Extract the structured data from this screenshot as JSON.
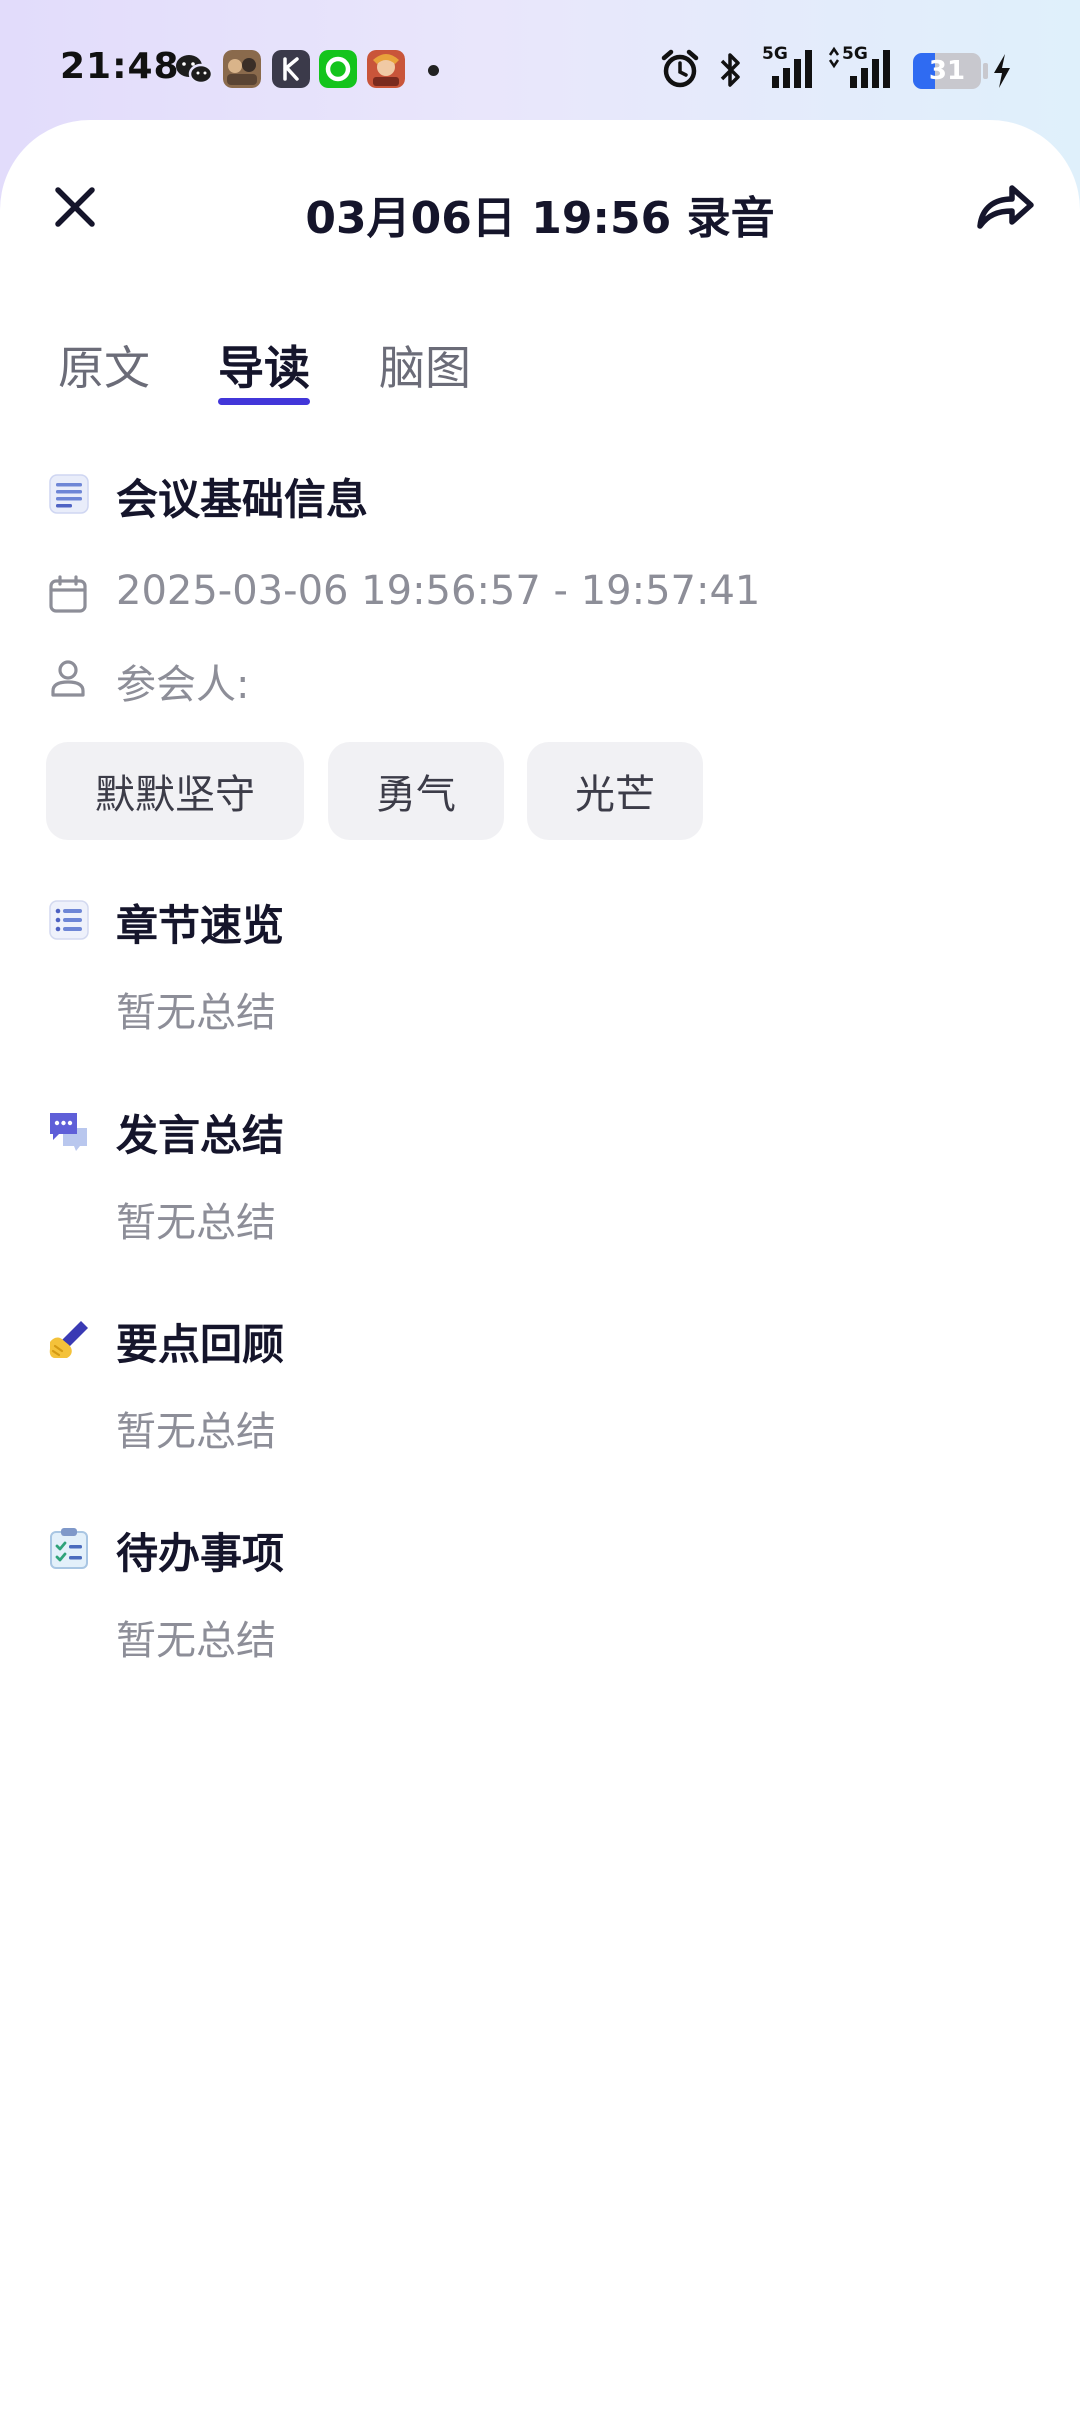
{
  "status_bar": {
    "time": "21:48",
    "network_5g_1": "5G",
    "network_5g_2": "5G",
    "battery": "31",
    "icons": [
      "wechat-icon",
      "game-app-icon",
      "k-app-icon",
      "green-app-icon",
      "hero-game-icon",
      "alarm-icon",
      "bluetooth-icon",
      "signal-icon",
      "battery-icon",
      "charging-icon"
    ]
  },
  "header": {
    "title": "03月06日 19:56 录音"
  },
  "tabs": [
    {
      "label": "原文",
      "active": false
    },
    {
      "label": "导读",
      "active": true
    },
    {
      "label": "脑图",
      "active": false
    }
  ],
  "meeting_info": {
    "title": "会议基础信息",
    "datetime": "2025-03-06 19:56:57 - 19:57:41",
    "participants_label": "参会人:",
    "participants": [
      "默默坚守",
      "勇气",
      "光芒"
    ]
  },
  "sections": [
    {
      "title": "章节速览",
      "content": "暂无总结"
    },
    {
      "title": "发言总结",
      "content": "暂无总结"
    },
    {
      "title": "要点回顾",
      "content": "暂无总结"
    },
    {
      "title": "待办事项",
      "content": "暂无总结"
    }
  ],
  "colors": {
    "accent": "#4236d9",
    "title_text": "#15152b",
    "muted_text": "#8d8e98",
    "chip_bg": "#f1f1f4"
  }
}
